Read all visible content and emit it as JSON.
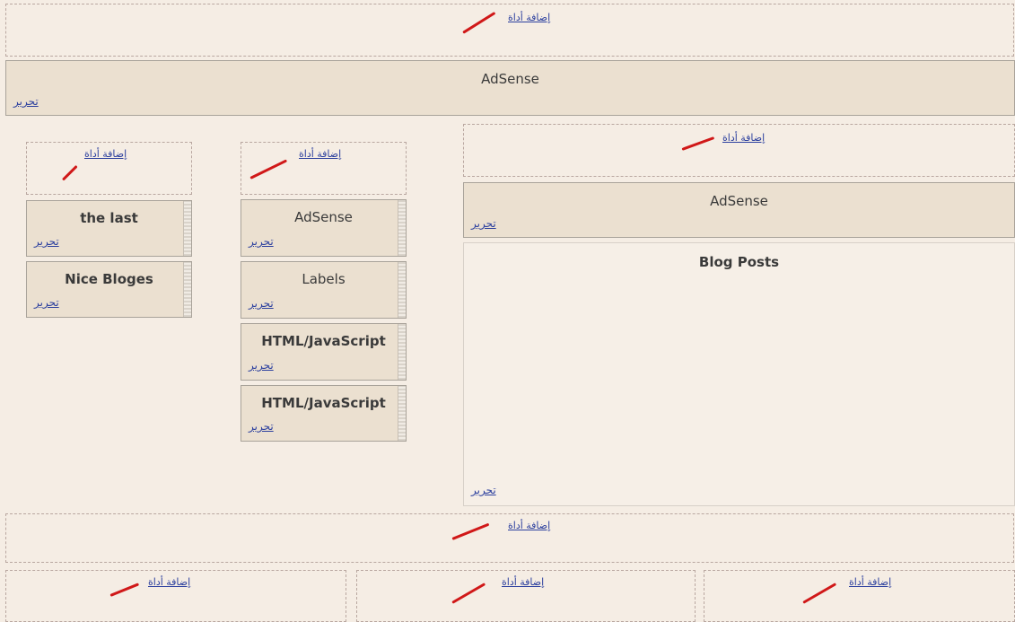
{
  "add_widget": "إضافة أداة",
  "edit": "تحرير",
  "header_widget": {
    "title": "AdSense"
  },
  "left_column": {
    "widgets": [
      {
        "title": "the last"
      },
      {
        "title": "Nice Bloges"
      }
    ]
  },
  "middle_column": {
    "widgets": [
      {
        "title": "AdSense"
      },
      {
        "title": "Labels"
      },
      {
        "title": "HTML/JavaScript"
      },
      {
        "title": "HTML/JavaScript"
      }
    ]
  },
  "main_column": {
    "widgets": [
      {
        "title": "AdSense"
      },
      {
        "title": "Blog Posts"
      }
    ]
  },
  "colors": {
    "edit_link": "#2b3f9e",
    "marker": "#d01818",
    "page_bg": "#f5ede4",
    "widget_bg": "#ebe0d0"
  }
}
